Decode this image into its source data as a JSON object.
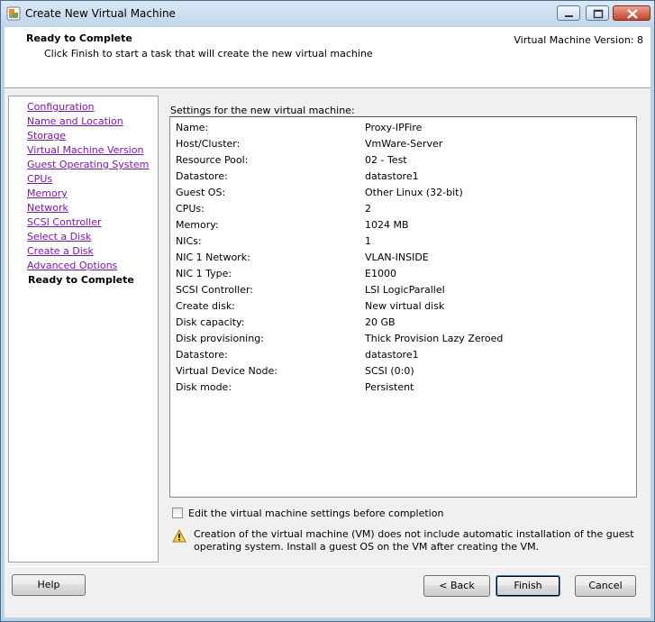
{
  "window": {
    "title": "Create New Virtual Machine",
    "icon": "vmware-logo-icon"
  },
  "header": {
    "title": "Ready to Complete",
    "subtitle": "Click Finish to start a task that will create the new virtual machine",
    "version": "Virtual Machine Version: 8"
  },
  "nav": {
    "items": [
      {
        "label": "Configuration"
      },
      {
        "label": "Name and Location"
      },
      {
        "label": "Storage"
      },
      {
        "label": "Virtual Machine Version"
      },
      {
        "label": "Guest Operating System"
      },
      {
        "label": "CPUs"
      },
      {
        "label": "Memory"
      },
      {
        "label": "Network"
      },
      {
        "label": "SCSI Controller"
      },
      {
        "label": "Select a Disk"
      },
      {
        "label": "Create a Disk"
      },
      {
        "label": "Advanced Options"
      }
    ],
    "current": "Ready to Complete"
  },
  "settings": {
    "label": "Settings for the new virtual machine:",
    "rows": [
      {
        "key": "Name:",
        "value": "Proxy-IPFire"
      },
      {
        "key": "Host/Cluster:",
        "value": "VmWare-Server"
      },
      {
        "key": "Resource Pool:",
        "value": "02 - Test"
      },
      {
        "key": "Datastore:",
        "value": "datastore1"
      },
      {
        "key": "Guest OS:",
        "value": "Other Linux (32-bit)"
      },
      {
        "key": "CPUs:",
        "value": "2"
      },
      {
        "key": "Memory:",
        "value": "1024 MB"
      },
      {
        "key": "NICs:",
        "value": "1"
      },
      {
        "key": "NIC 1 Network:",
        "value": "VLAN-INSIDE"
      },
      {
        "key": "NIC 1 Type:",
        "value": "E1000"
      },
      {
        "key": "SCSI Controller:",
        "value": "LSI LogicParallel"
      },
      {
        "key": "Create disk:",
        "value": "New virtual disk"
      },
      {
        "key": "Disk capacity:",
        "value": "20 GB"
      },
      {
        "key": "Disk provisioning:",
        "value": "Thick Provision Lazy Zeroed"
      },
      {
        "key": "Datastore:",
        "value": "datastore1"
      },
      {
        "key": "Virtual Device Node:",
        "value": "SCSI (0:0)"
      },
      {
        "key": "Disk mode:",
        "value": "Persistent"
      }
    ]
  },
  "edit_checkbox": {
    "label": "Edit the virtual machine settings before completion",
    "checked": false
  },
  "warning": {
    "icon": "warning-icon",
    "text": "Creation of the virtual machine (VM) does not include automatic installation of the guest operating system. Install a guest OS on the VM after creating the VM."
  },
  "buttons": {
    "help": "Help",
    "back": "< Back",
    "finish": "Finish",
    "cancel": "Cancel"
  }
}
